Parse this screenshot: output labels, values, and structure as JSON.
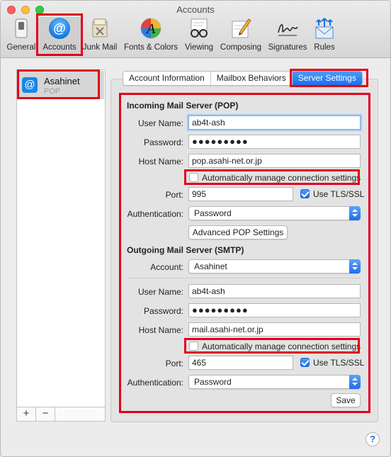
{
  "window": {
    "title": "Accounts"
  },
  "toolbar": {
    "items": [
      {
        "label": "General",
        "icon": "general-switch-icon"
      },
      {
        "label": "Accounts",
        "icon": "at-sign-icon"
      },
      {
        "label": "Junk Mail",
        "icon": "junk-mail-icon"
      },
      {
        "label": "Fonts & Colors",
        "icon": "fonts-colors-icon"
      },
      {
        "label": "Viewing",
        "icon": "glasses-icon"
      },
      {
        "label": "Composing",
        "icon": "pencil-icon"
      },
      {
        "label": "Signatures",
        "icon": "signature-icon"
      },
      {
        "label": "Rules",
        "icon": "rules-icon"
      }
    ],
    "selected": "Accounts"
  },
  "sidebar": {
    "accounts": [
      {
        "name": "Asahinet",
        "type": "POP"
      }
    ],
    "add_label": "+",
    "remove_label": "−"
  },
  "tabs": [
    {
      "label": "Account Information",
      "active": false
    },
    {
      "label": "Mailbox Behaviors",
      "active": false
    },
    {
      "label": "Server Settings",
      "active": true
    }
  ],
  "incoming": {
    "section_title": "Incoming Mail Server (POP)",
    "user_name_label": "User Name:",
    "user_name": "ab4t-ash",
    "password_label": "Password:",
    "password": "●●●●●●●●●",
    "host_name_label": "Host Name:",
    "host_name": "pop.asahi-net.or.jp",
    "auto_manage_label": "Automatically manage connection settings",
    "auto_manage_checked": false,
    "port_label": "Port:",
    "port": "995",
    "tls_label": "Use TLS/SSL",
    "tls_checked": true,
    "auth_label": "Authentication:",
    "auth_value": "Password",
    "advanced_button": "Advanced POP Settings"
  },
  "outgoing": {
    "section_title": "Outgoing Mail Server (SMTP)",
    "account_label": "Account:",
    "account_value": "Asahinet",
    "user_name_label": "User Name:",
    "user_name": "ab4t-ash",
    "password_label": "Password:",
    "password": "●●●●●●●●●",
    "host_name_label": "Host Name:",
    "host_name": "mail.asahi-net.or.jp",
    "auto_manage_label": "Automatically manage connection settings",
    "auto_manage_checked": false,
    "port_label": "Port:",
    "port": "465",
    "tls_label": "Use TLS/SSL",
    "tls_checked": true,
    "auth_label": "Authentication:",
    "auth_value": "Password"
  },
  "save_button": "Save",
  "help_label": "?",
  "colors": {
    "accent": "#1b6ff0",
    "highlight": "#e2001a"
  }
}
